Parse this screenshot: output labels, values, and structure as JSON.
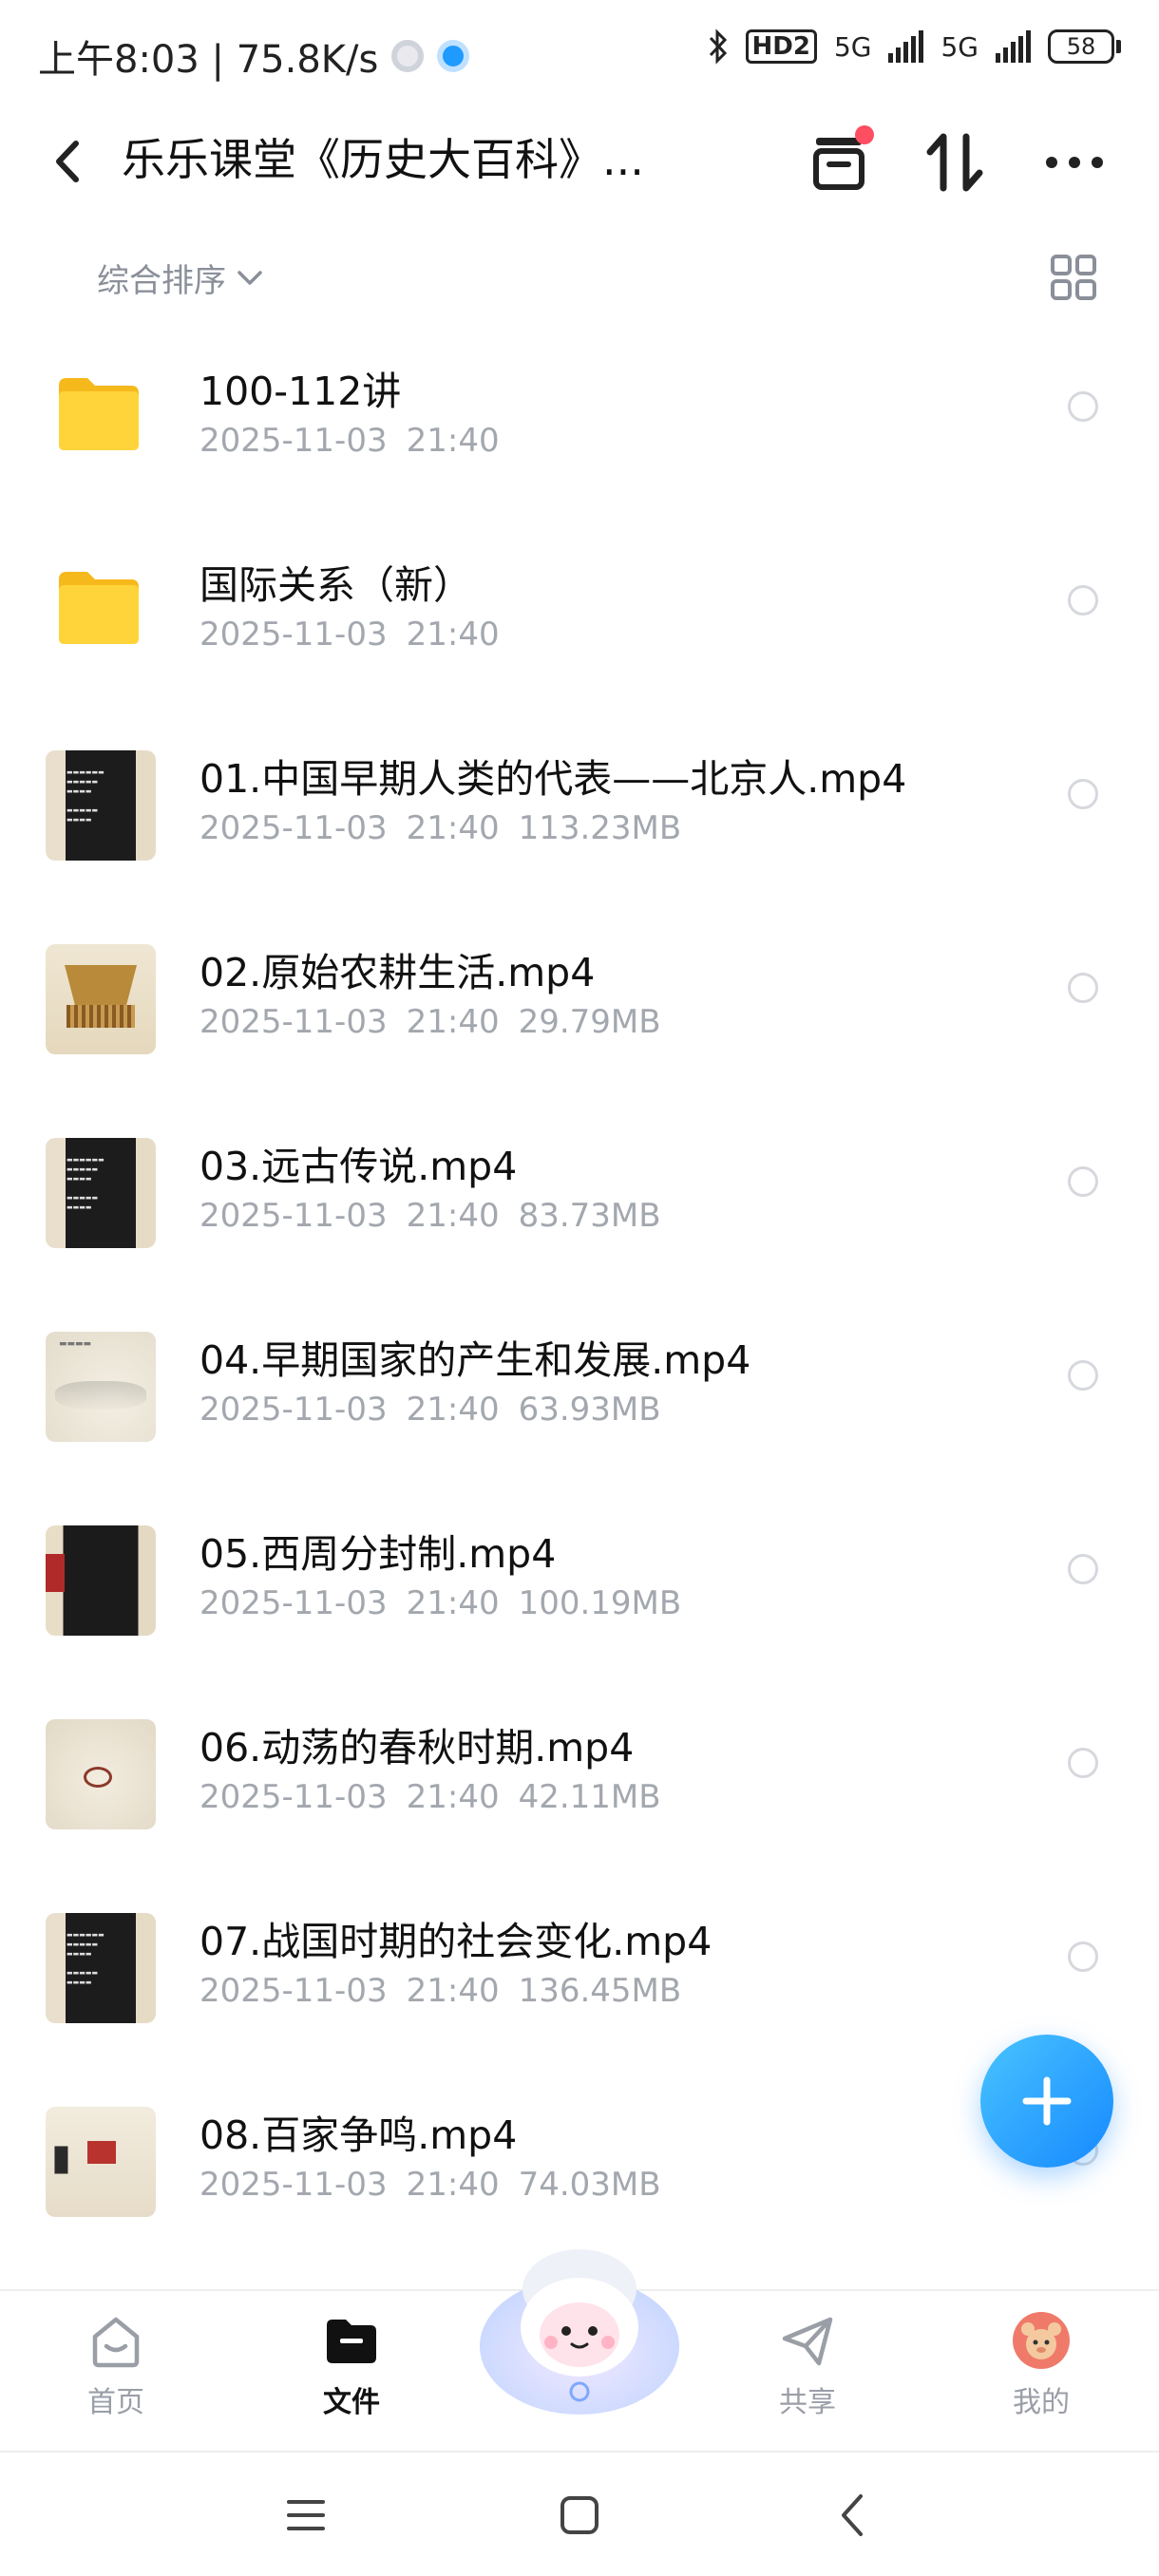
{
  "status_bar": {
    "time_speed": "上午8:03 | 75.8K/s",
    "hd_label": "HD2",
    "net1": "5G",
    "net2": "5G",
    "battery": "58"
  },
  "header": {
    "title": "乐乐课堂《历史大百科》..."
  },
  "sort": {
    "label": "综合排序"
  },
  "files": [
    {
      "name": "100-112讲",
      "date": "2025-11-03",
      "time": "21:40",
      "size": "",
      "type": "folder"
    },
    {
      "name": "国际关系（新）",
      "date": "2025-11-03",
      "time": "21:40",
      "size": "",
      "type": "folder"
    },
    {
      "name": "01.中国早期人类的代表——北京人.mp4",
      "date": "2025-11-03",
      "time": "21:40",
      "size": "113.23MB",
      "type": "video-dark"
    },
    {
      "name": "02.原始农耕生活.mp4",
      "date": "2025-11-03",
      "time": "21:40",
      "size": "29.79MB",
      "type": "video-hut"
    },
    {
      "name": "03.远古传说.mp4",
      "date": "2025-11-03",
      "time": "21:40",
      "size": "83.73MB",
      "type": "video-dark"
    },
    {
      "name": "04.早期国家的产生和发展.mp4",
      "date": "2025-11-03",
      "time": "21:40",
      "size": "63.93MB",
      "type": "video-paper"
    },
    {
      "name": "05.西周分封制.mp4",
      "date": "2025-11-03",
      "time": "21:40",
      "size": "100.19MB",
      "type": "video-dark2"
    },
    {
      "name": "06.动荡的春秋时期.mp4",
      "date": "2025-11-03",
      "time": "21:40",
      "size": "42.11MB",
      "type": "video-rider"
    },
    {
      "name": "07.战国时期的社会变化.mp4",
      "date": "2025-11-03",
      "time": "21:40",
      "size": "136.45MB",
      "type": "video-dark"
    },
    {
      "name": "08.百家争鸣.mp4",
      "date": "2025-11-03",
      "time": "21:40",
      "size": "74.03MB",
      "type": "video-ren"
    }
  ],
  "bottom_nav": {
    "home": "首页",
    "files": "文件",
    "share": "共享",
    "mine": "我的"
  },
  "colors": {
    "accent": "#1689ff",
    "folder": "#ffc928",
    "badge_red": "#ff4d61"
  }
}
